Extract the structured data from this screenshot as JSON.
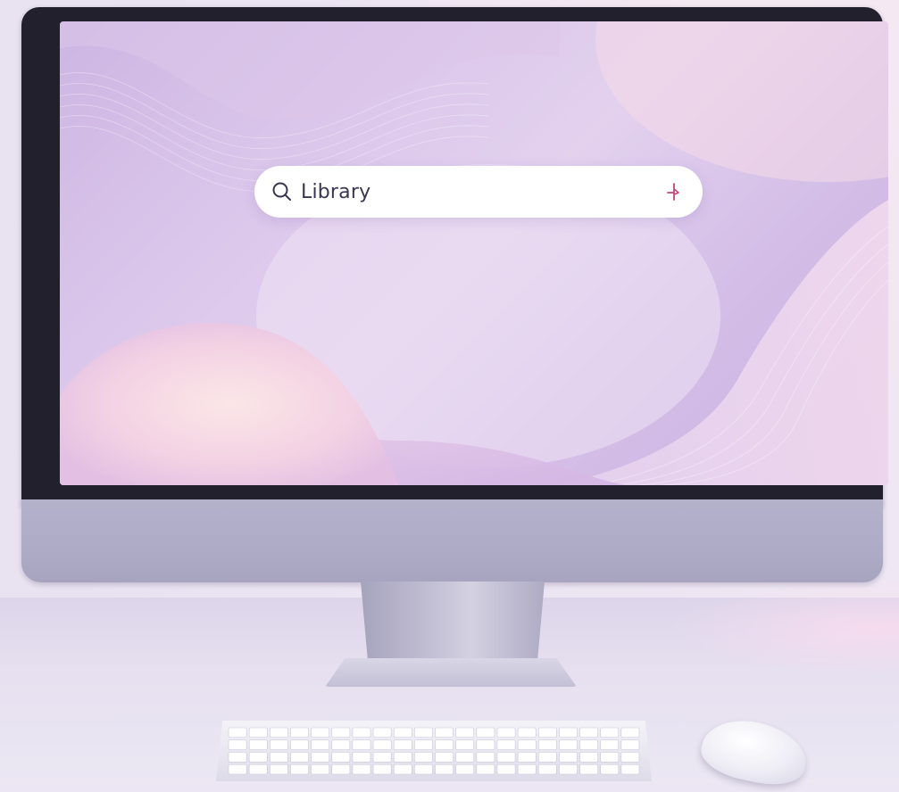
{
  "search": {
    "query": "Library",
    "left_icon": "search-icon",
    "right_icon": "sparkle-icon",
    "accent_color": "#c0457a"
  },
  "theme": {
    "wallpaper_colors": [
      "#cdb5e2",
      "#e3d1ee",
      "#f6dbe8"
    ],
    "bezel_color": "#23202e",
    "chin_color": "#aeabc6"
  }
}
